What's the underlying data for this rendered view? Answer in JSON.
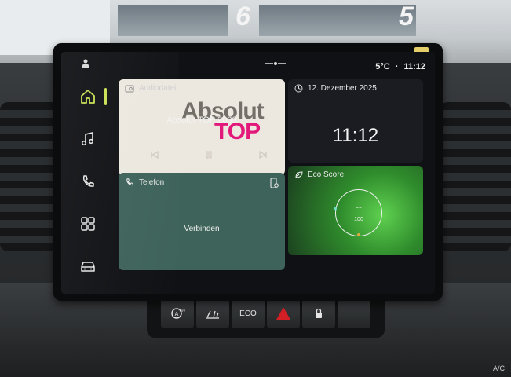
{
  "status_bar": {
    "temperature": "5°C",
    "separator": "·",
    "time": "11:12"
  },
  "sidebar": {
    "items": [
      {
        "name": "home",
        "icon": "home-icon",
        "active": true
      },
      {
        "name": "media",
        "icon": "music-note-icon",
        "active": false
      },
      {
        "name": "phone",
        "icon": "phone-icon",
        "active": false
      },
      {
        "name": "apps",
        "icon": "grid-icon",
        "active": false
      },
      {
        "name": "vehicle",
        "icon": "car-icon",
        "active": false
      }
    ]
  },
  "media_tile": {
    "header": "Audiodatei",
    "station_logo_line1": "Absolut",
    "station_logo_line2": "TOP",
    "title": "Absolut TOP 2000",
    "controls": [
      "prev",
      "pause",
      "next"
    ]
  },
  "date_tile": {
    "date": "12. Dezember 2025",
    "time": "11:12"
  },
  "phone_tile": {
    "header": "Telefon",
    "action": "Verbinden"
  },
  "eco_tile": {
    "header": "Eco Score",
    "score_display": "--",
    "value": "100"
  },
  "hardware_buttons": {
    "eco_label": "ECO",
    "ac_label": "A/C"
  },
  "colors": {
    "accent": "#c8e052",
    "phone_tile": "#3e635a",
    "eco_tile": "#2f8c2c",
    "media_tile": "#ece8df",
    "date_tile": "#1b1c22",
    "logo_pink": "#e2197a",
    "hazard_red": "#d31f26"
  }
}
